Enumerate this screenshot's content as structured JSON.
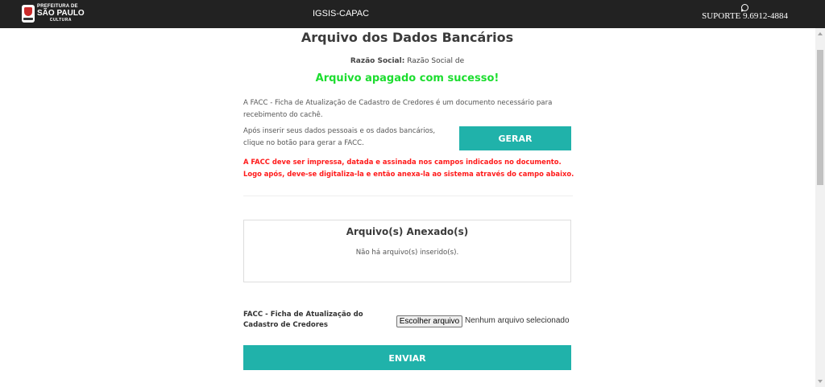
{
  "header": {
    "logo": {
      "line1": "PREFEITURA DE",
      "line2": "SÃO PAULO",
      "line3": "CULTURA"
    },
    "app_title": "IGSIS-CAPAC",
    "support_icon": "whatsapp-icon",
    "support_text": "SUPORTE 9.6912-4884"
  },
  "main": {
    "title": "Arquivo dos Dados Bancários",
    "razao_label": "Razão Social:",
    "razao_value": "Razão Social de",
    "success_message": "Arquivo apagado com sucesso!",
    "intro_text": "A FACC - Ficha de Atualização de Cadastro de Credores é um documento necessário para recebimento do cachê.",
    "instructions_text": "Após inserir seus dados pessoais e os dados bancários, clique no botão para gerar a FACC.",
    "generate_button": "GERAR",
    "warning_text": "A FACC deve ser impressa, datada e assinada nos campos indicados no documento. Logo após, deve-se digitaliza-la e então anexa-la ao sistema através do campo abaixo.",
    "attachments": {
      "title": "Arquivo(s) Anexado(s)",
      "empty_message": "Não há arquivo(s) inserido(s)."
    },
    "upload": {
      "label": "FACC - Ficha de Atualização do Cadastro de Credores",
      "choose_button": "Escolher arquivo",
      "status": "Nenhum arquivo selecionado"
    },
    "submit_button": "ENVIAR"
  },
  "colors": {
    "topbar": "#222222",
    "accent": "#20b2aa",
    "success": "#1cdd2f",
    "warning": "#ff1a1a"
  }
}
